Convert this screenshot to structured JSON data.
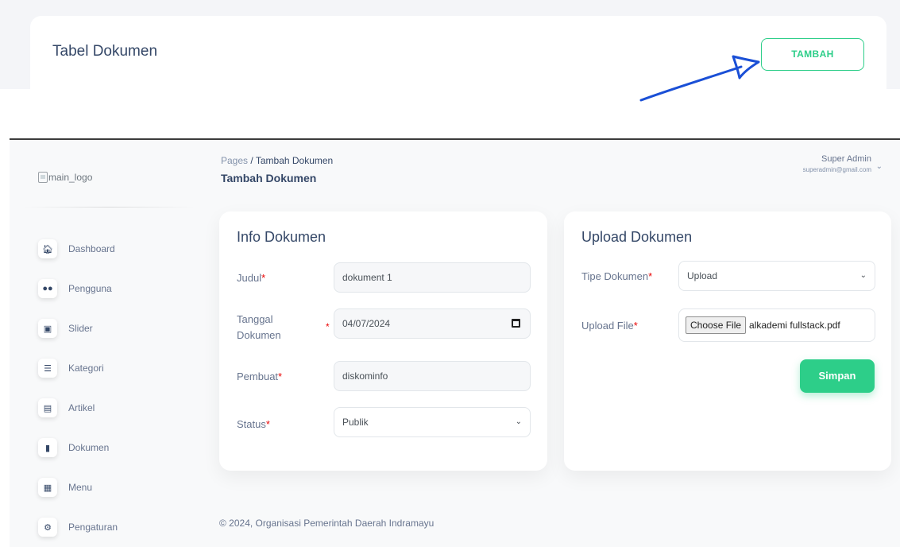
{
  "list_page": {
    "card_title": "Tabel Dokumen",
    "add_button": "TAMBAH"
  },
  "sidebar": {
    "logo_alt": "main_logo",
    "items": [
      {
        "label": "Dashboard",
        "icon": "home-icon"
      },
      {
        "label": "Pengguna",
        "icon": "users-icon"
      },
      {
        "label": "Slider",
        "icon": "image-icon"
      },
      {
        "label": "Kategori",
        "icon": "list-icon"
      },
      {
        "label": "Artikel",
        "icon": "article-icon"
      },
      {
        "label": "Dokumen",
        "icon": "document-icon"
      },
      {
        "label": "Menu",
        "icon": "menu-icon"
      },
      {
        "label": "Pengaturan",
        "icon": "gears-icon"
      }
    ]
  },
  "header": {
    "breadcrumb_root": "Pages",
    "breadcrumb_sep": "/",
    "breadcrumb_current": "Tambah Dokumen",
    "page_title": "Tambah Dokumen",
    "user_name": "Super Admin",
    "user_email": "superadmin@gmail.com"
  },
  "info_card": {
    "title": "Info Dokumen",
    "judul_label": "Judul",
    "judul_value": "dokument 1",
    "tanggal_label": "Tanggal Dokumen",
    "tanggal_value": "04/07/2024",
    "pembuat_label": "Pembuat",
    "pembuat_value": "diskominfo",
    "status_label": "Status",
    "status_value": "Publik"
  },
  "upload_card": {
    "title": "Upload Dokumen",
    "tipe_label": "Tipe Dokumen",
    "tipe_value": "Upload",
    "file_label": "Upload File",
    "file_button": "Choose File",
    "file_name": "alkademi fullstack.pdf",
    "save_button": "Simpan"
  },
  "footer": {
    "text": "© 2024, Organisasi Pemerintah Daerah Indramayu"
  },
  "colors": {
    "accent_green": "#2dce89",
    "required_red": "#ea0606",
    "annotation_blue": "#1a4fd6",
    "text_dark": "#344767"
  }
}
